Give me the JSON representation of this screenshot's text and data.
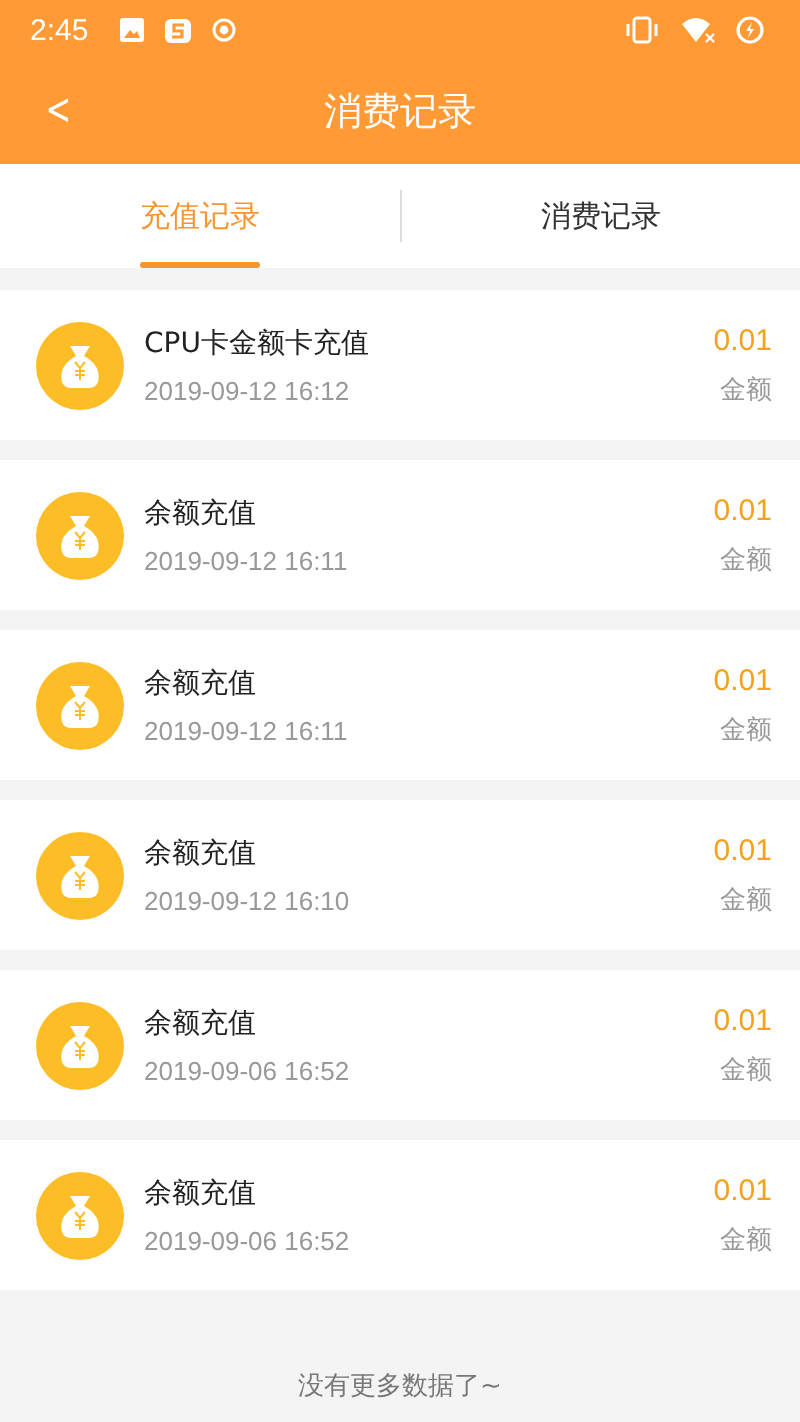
{
  "status_bar": {
    "time": "2:45"
  },
  "header": {
    "back": "<",
    "title": "消费记录"
  },
  "tabs": [
    {
      "label": "充值记录",
      "selected": true
    },
    {
      "label": "消费记录",
      "selected": false
    }
  ],
  "records": [
    {
      "title": "CPU卡金额卡充值",
      "time": "2019-09-12 16:12",
      "amount": "0.01",
      "amount_label": "金额"
    },
    {
      "title": "余额充值",
      "time": "2019-09-12 16:11",
      "amount": "0.01",
      "amount_label": "金额"
    },
    {
      "title": "余额充值",
      "time": "2019-09-12 16:11",
      "amount": "0.01",
      "amount_label": "金额"
    },
    {
      "title": "余额充值",
      "time": "2019-09-12 16:10",
      "amount": "0.01",
      "amount_label": "金额"
    },
    {
      "title": "余额充值",
      "time": "2019-09-06 16:52",
      "amount": "0.01",
      "amount_label": "金额"
    },
    {
      "title": "余额充值",
      "time": "2019-09-06 16:52",
      "amount": "0.01",
      "amount_label": "金额"
    }
  ],
  "footer": "没有更多数据了~"
}
